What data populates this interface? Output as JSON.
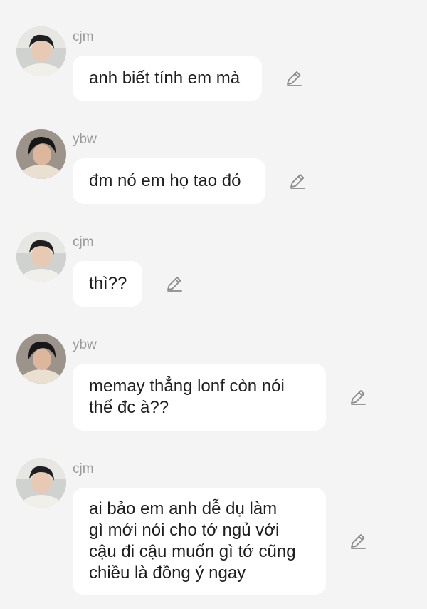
{
  "messages": [
    {
      "sender": "cjm",
      "avatar": "cjm-avatar",
      "text": "anh biết tính em mà"
    },
    {
      "sender": "ybw",
      "avatar": "ybw-avatar",
      "text": "đm nó em họ tao đó"
    },
    {
      "sender": "cjm",
      "avatar": "cjm-avatar",
      "text": "thì??"
    },
    {
      "sender": "ybw",
      "avatar": "ybw-avatar",
      "text": "memay thẳng lonf còn nói\nthế đc à??"
    },
    {
      "sender": "cjm",
      "avatar": "cjm-avatar",
      "text": "ai bảo em anh dễ dụ làm\ngì mới nói cho tớ ngủ với\ncậu đi cậu muốn gì tớ cũng\nchiều là đồng ý ngay"
    }
  ],
  "icons": {
    "edit": "pencil-edit-icon"
  },
  "colors": {
    "background": "#f4f4f4",
    "bubble": "#ffffff",
    "sender": "#9a9a9a",
    "text": "#1e1e1e",
    "icon": "#8a8a8a"
  }
}
